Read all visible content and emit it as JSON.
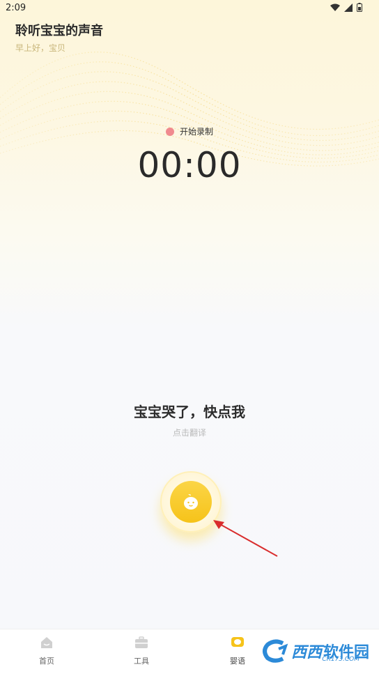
{
  "status_bar": {
    "time": "2:09"
  },
  "header": {
    "title": "聆听宝宝的声音",
    "subtitle": "早上好，宝贝"
  },
  "recorder": {
    "label": "开始录制",
    "timer": "00:00"
  },
  "cta": {
    "title": "宝宝哭了，快点我",
    "subtitle": "点击翻译"
  },
  "nav": {
    "items": [
      {
        "label": "首页",
        "icon": "home-icon"
      },
      {
        "label": "工具",
        "icon": "toolbox-icon"
      },
      {
        "label": "婴语",
        "icon": "baby-chat-icon"
      }
    ]
  },
  "watermark": {
    "brand": "西西",
    "brand2": "软件园",
    "domain": "CR173.COM"
  },
  "colors": {
    "accent": "#f6c31a",
    "record_dot": "#f08a8f",
    "arrow": "#d92d2d"
  }
}
